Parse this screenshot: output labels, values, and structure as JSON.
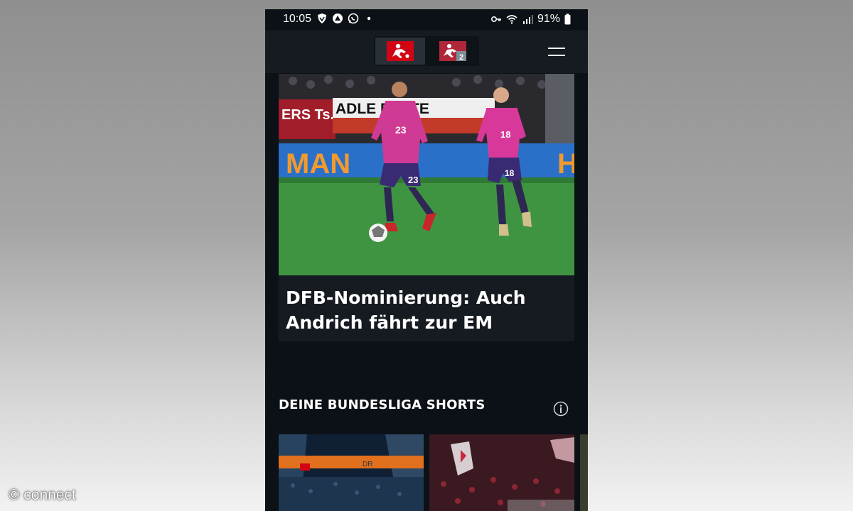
{
  "status_bar": {
    "time": "10:05",
    "battery": "91%"
  },
  "app_bar": {
    "leagues": [
      {
        "name": "Bundesliga",
        "icon": "bundesliga-logo",
        "active": true
      },
      {
        "name": "2. Bundesliga",
        "icon": "bundesliga2-logo",
        "active": false
      }
    ],
    "menu_icon": "hamburger-icon"
  },
  "hero": {
    "ad_board_left": "ERS Ts.",
    "ad_board_mid": "ADLE  RETTE",
    "ad_board_low": "MAN",
    "player1_number": "23",
    "player2_number": "18",
    "headline": "DFB-Nominierung: Auch Andrich fährt zur EM"
  },
  "shorts_section": {
    "title": "DEINE BUNDESLIGA SHORTS",
    "info_icon": "info-icon",
    "card1_board_text": "DR"
  },
  "watermark": "© connect",
  "colors": {
    "background_dark": "#0b1116",
    "bar_dark": "#161b22",
    "bundesliga_red": "#d20515",
    "jersey_pink": "#d8389a",
    "pitch_green": "#3a8e3e"
  }
}
